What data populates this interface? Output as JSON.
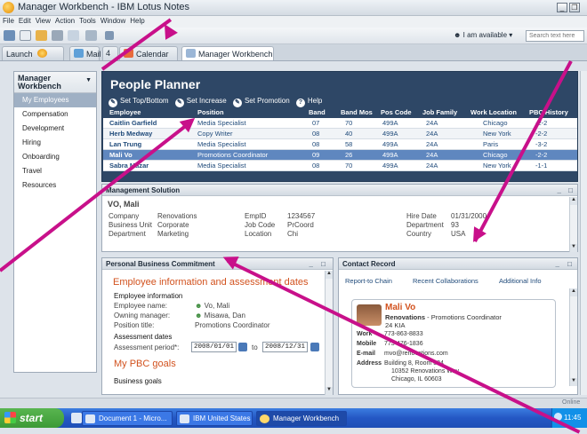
{
  "window": {
    "title": "Manager Workbench - IBM Lotus Notes",
    "min_glyph": "_",
    "restore_glyph": "❐"
  },
  "menu": [
    "File",
    "Edit",
    "View",
    "Action",
    "Tools",
    "Window",
    "Help"
  ],
  "toolbar": {
    "availability": "I am available",
    "search_placeholder": "Search text here"
  },
  "tabs": [
    {
      "label": "Launch"
    },
    {
      "label": "Mail"
    },
    {
      "label": "4"
    },
    {
      "label": "Calendar"
    },
    {
      "label": "Manager Workbench"
    }
  ],
  "sidebar": {
    "title_line1": "Manager",
    "title_line2": "Workbench",
    "items": [
      "My Employees",
      "Compensation",
      "Development",
      "Hiring",
      "Onboarding",
      "Travel",
      "Resources"
    ]
  },
  "planner": {
    "title": "People Planner",
    "actions": [
      "Set Top/Bottom",
      "Set Increase",
      "Set Promotion",
      "Help"
    ],
    "columns": [
      "Employee",
      "Position",
      "Band",
      "Band Mos",
      "Pos Code",
      "Job Family",
      "Work Location",
      "PBC History"
    ],
    "rows": [
      [
        "Caitlin Garfield",
        "Media Specialist",
        "07",
        "70",
        "499A",
        "24A",
        "Chicago",
        "-2-2"
      ],
      [
        "Herb Medway",
        "Copy Writer",
        "08",
        "40",
        "499A",
        "24A",
        "New York",
        "-2-2"
      ],
      [
        "Lan Trung",
        "Media Specialist",
        "08",
        "58",
        "499A",
        "24A",
        "Paris",
        "-3-2"
      ],
      [
        "Mali Vo",
        "Promotions Coordinator",
        "09",
        "26",
        "499A",
        "24A",
        "Chicago",
        "-2-2"
      ],
      [
        "Sabra Mazar",
        "Media Specialist",
        "08",
        "70",
        "499A",
        "24A",
        "New York",
        "-1-1"
      ]
    ],
    "selected_row": 3
  },
  "management": {
    "title": "Management Solution",
    "name": "VO, Mali",
    "company_label": "Company",
    "company": "Renovations",
    "unit_label": "Business Unit",
    "unit": "Corporate",
    "dept_label": "Department",
    "dept": "Marketing",
    "empid_label": "EmpID",
    "empid": "1234567",
    "jobcode_label": "Job Code",
    "jobcode": "PrCoord",
    "location_label": "Location",
    "location": "Chi",
    "hire_label": "Hire Date",
    "hire": "01/31/2000",
    "dept2_label": "Department",
    "dept2": "93",
    "country_label": "Country",
    "country": "USA"
  },
  "pbc": {
    "title": "Personal Business Commitment",
    "heading": "Employee information and assessment dates",
    "info_title": "Employee information",
    "name_label": "Employee name:",
    "name": "Vo, Mali",
    "manager_label": "Owning manager:",
    "manager": "Misawa, Dan",
    "position_label": "Position title:",
    "position": "Promotions Coordinator",
    "dates_title": "Assessment dates",
    "period_label": "Assessment period*:",
    "date_from": "2008/01/01",
    "to": "to",
    "date_to": "2008/12/31",
    "goals_heading": "My PBC goals",
    "business_goals": "Business goals"
  },
  "contact": {
    "title": "Contact Record",
    "links": [
      "Report-to Chain",
      "Recent Collaborations",
      "Additional Info"
    ],
    "name": "Mali Vo",
    "company": "Renovations",
    "role": "- Promotions Coordinator",
    "line3": "24 KIA",
    "work_label": "Work",
    "work": "773-863-8833",
    "mobile_label": "Mobile",
    "mobile": "773-476-1836",
    "email_label": "E-mail",
    "email": "mvo@renovations.com",
    "address_label": "Address",
    "address1": "Building 8, Room 334",
    "address2": "10352 Renovations Way",
    "address3": "Chicago, IL 60603"
  },
  "status": {
    "online": "Online"
  },
  "taskbar": {
    "start": "start",
    "buttons": [
      "Document 1 - Micro...",
      "IBM United States -...",
      "Manager Workbench"
    ],
    "clock": "11:45"
  }
}
